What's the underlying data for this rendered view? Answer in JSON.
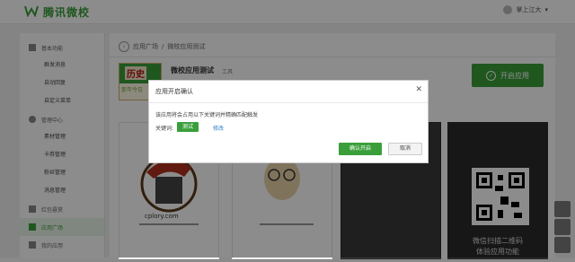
{
  "brand": {
    "name": "腾讯微校"
  },
  "user": {
    "name": "掌上江大"
  },
  "sidebar": {
    "groups": [
      {
        "label": "基本功能",
        "items": [
          "群发消息",
          "自动回复",
          "自定义菜单"
        ]
      },
      {
        "label": "管理中心",
        "items": [
          "素材管理",
          "卡券管理",
          "粉丝管理",
          "消息管理"
        ]
      }
    ],
    "redpacket": "红包悬赏",
    "app_square": "应用广场",
    "my_apps": "我的应用"
  },
  "breadcrumb": {
    "root": "应用广场",
    "sep": "/",
    "current": "微校应用测试"
  },
  "app": {
    "thumb_title": "历史",
    "thumb_sub": "那年今日",
    "title": "微校应用测试",
    "tag": "工具",
    "enable_label": "开启应用"
  },
  "cards": {
    "card1_caption": "cplory.com",
    "qr_label_1": "微信扫描二维码",
    "qr_label_2": "体验应用功能"
  },
  "modal": {
    "title": "应用开启确认",
    "description": "该应用将会占用以下关键词并精确匹配触发",
    "keyword_label": "关键词:",
    "keyword": "测试",
    "edit_label": "修改",
    "confirm_label": "确认开启",
    "cancel_label": "取消"
  },
  "colors": {
    "accent": "#3a9f3a",
    "link": "#2d7fc1"
  }
}
